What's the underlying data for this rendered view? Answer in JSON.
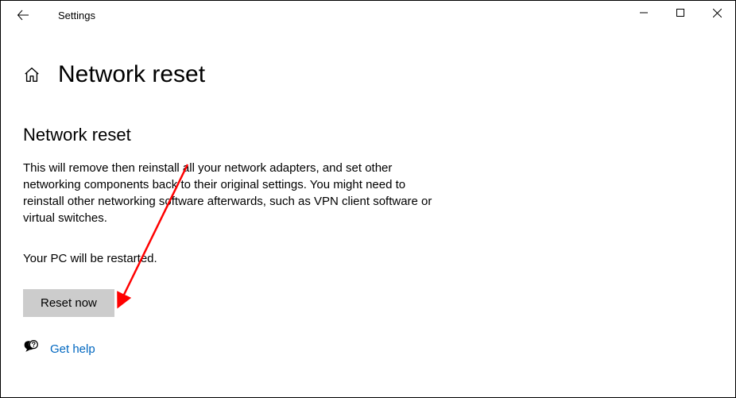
{
  "titlebar": {
    "app_name": "Settings"
  },
  "page": {
    "title": "Network reset",
    "section_heading": "Network reset",
    "description": "This will remove then reinstall all your network adapters, and set other networking components back to their original settings. You might need to reinstall other networking software afterwards, such as VPN client software or virtual switches.",
    "restart_note": "Your PC will be restarted.",
    "reset_button_label": "Reset now"
  },
  "help": {
    "link_label": "Get help"
  },
  "annotation": {
    "arrow_color": "#ff0000"
  }
}
